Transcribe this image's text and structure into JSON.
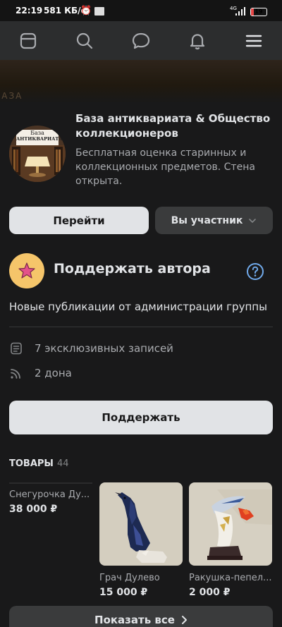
{
  "status_bar": {
    "time": "22:19",
    "speed": "581 КБ/с",
    "network": "4G",
    "battery": "19",
    "battery_level": 0.19
  },
  "nav": {
    "icons": [
      "feed-icon",
      "search-icon",
      "messages-icon",
      "notifications-icon",
      "menu-icon"
    ]
  },
  "cover": {
    "text": "БАЗА"
  },
  "group": {
    "title": "База антиквариата & Общество коллекционеров",
    "description": "Бесплатная оценка старинных и коллекционных предметов. Стена открыта.",
    "avatar_text_line1": "База",
    "avatar_text_line2": "АНТИКВАРИАТА"
  },
  "actions": {
    "go_label": "Перейти",
    "member_label": "Вы участник"
  },
  "support": {
    "title": "Поддержать автора",
    "subtitle": "Новые публикации от администрации группы",
    "posts_text": "7 эксклюзивных записей",
    "dons_text": "2 дона",
    "button_label": "Поддержать"
  },
  "goods": {
    "heading": "ТОВАРЫ",
    "count": "44",
    "items": [
      {
        "name": "Снегурочка Ду...",
        "price": "38 000 ₽"
      },
      {
        "name": "Грач Дулево",
        "price": "15 000 ₽"
      },
      {
        "name": "Ракушка-пепел...",
        "price": "2 000 ₽"
      }
    ],
    "show_all_label": "Показать все"
  },
  "colors": {
    "background": "#19191a",
    "nav_background": "#2c2d2e",
    "primary_button": "#e1e3e6",
    "secondary_button": "#3a3b3c",
    "accent_blue": "#71aaeb",
    "star_badge": "#f5c56a"
  }
}
